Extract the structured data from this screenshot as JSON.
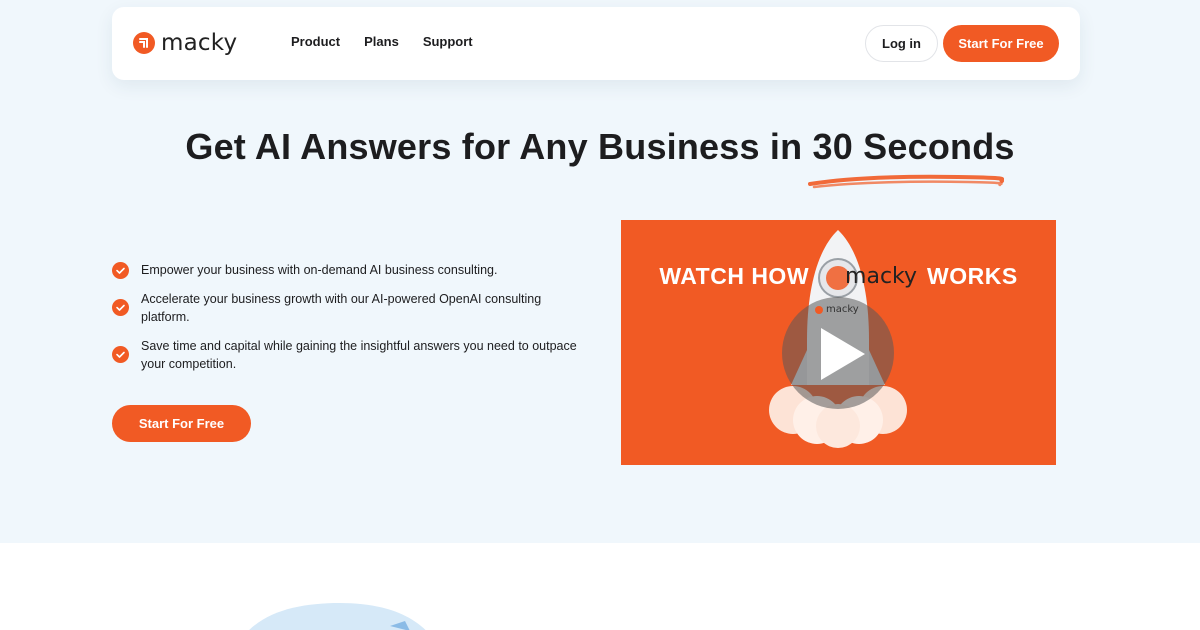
{
  "brand": {
    "name": "macky",
    "accent": "#f15a24",
    "background": "#f0f7fc"
  },
  "nav": {
    "links": [
      "Product",
      "Plans",
      "Support"
    ],
    "login_label": "Log in",
    "cta_label": "Start For Free"
  },
  "hero": {
    "headline": "Get AI Answers for Any Business in 30 Seconds",
    "features": [
      "Empower your business with on-demand AI business consulting.",
      "Accelerate your business growth with our AI-powered OpenAI consulting platform.",
      "Save time and capital while gaining the insightful answers you need to outpace your competition."
    ],
    "cta_label": "Start For Free"
  },
  "video": {
    "title_left": "WATCH HOW",
    "title_brand": "macky",
    "title_right": "WORKS",
    "rocket_label": "macky",
    "icon": "play-icon"
  }
}
